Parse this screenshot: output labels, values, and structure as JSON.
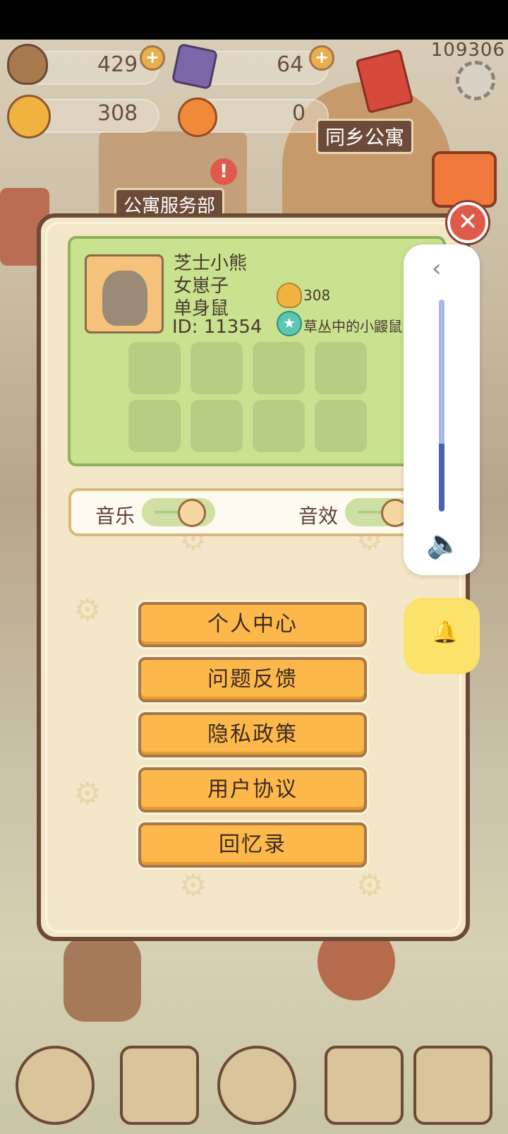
{
  "hud": {
    "acorns": "429",
    "gems": "64",
    "bells": "308",
    "oranges": "0",
    "counter": "109306"
  },
  "scene": {
    "sign_apartment": "同乡公寓",
    "sign_service": "公寓服务部"
  },
  "profile": {
    "name": "芝士小熊",
    "title": "女崽子",
    "status": "单身鼠",
    "id": "ID: 11354",
    "bells": "308",
    "rank": "草丛中的小鼹鼠"
  },
  "settings": {
    "music_label": "音乐",
    "sfx_label": "音效",
    "music_level": 0.75,
    "sfx_level": 0.75
  },
  "menu": [
    {
      "label": "个人中心"
    },
    {
      "label": "问题反馈"
    },
    {
      "label": "隐私政策"
    },
    {
      "label": "用户协议"
    },
    {
      "label": "回忆录"
    }
  ],
  "system_volume": {
    "level": 0.32
  },
  "icons": {
    "close": "close-icon",
    "chevron": "chevron-left-icon",
    "speaker": "speaker-icon",
    "bell": "bell-icon"
  }
}
